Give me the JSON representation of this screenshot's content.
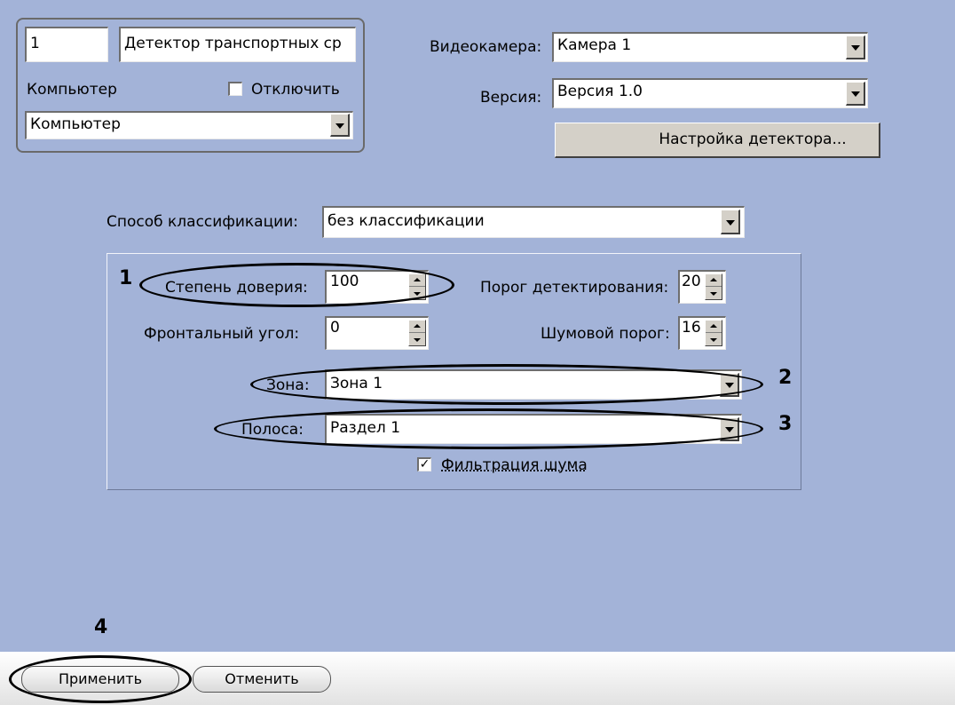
{
  "object_panel": {
    "id_value": "1",
    "name_value": "Детектор транспортных ср",
    "computer_label": "Компьютер",
    "disable_label": "Отключить",
    "disable_checked": false,
    "computer_select": "Компьютер"
  },
  "camera": {
    "label": "Видеокамера:",
    "value": "Камера 1"
  },
  "version": {
    "label": "Версия:",
    "value": "Версия 1.0"
  },
  "setup_button": "Настройка детектора...",
  "classification": {
    "label": "Способ классификации:",
    "value": "без классификации"
  },
  "params": {
    "trust_label": "Степень доверия:",
    "trust_value": "100",
    "detect_threshold_label": "Порог детектирования:",
    "detect_threshold_value": "20",
    "frontal_angle_label": "Фронтальный угол:",
    "frontal_angle_value": "0",
    "noise_threshold_label": "Шумовой порог:",
    "noise_threshold_value": "16",
    "zone_label": "Зона:",
    "zone_value": "Зона 1",
    "lane_label": "Полоса:",
    "lane_value": "Раздел 1",
    "noise_filter_label": "Фильтрация шума",
    "noise_filter_checked": true
  },
  "callouts": [
    "1",
    "2",
    "3",
    "4"
  ],
  "footer": {
    "apply_label": "Применить",
    "cancel_label": "Отменить"
  },
  "colors": {
    "panel_bg": "#a3b3d8",
    "control_face": "#d4d0c8"
  }
}
